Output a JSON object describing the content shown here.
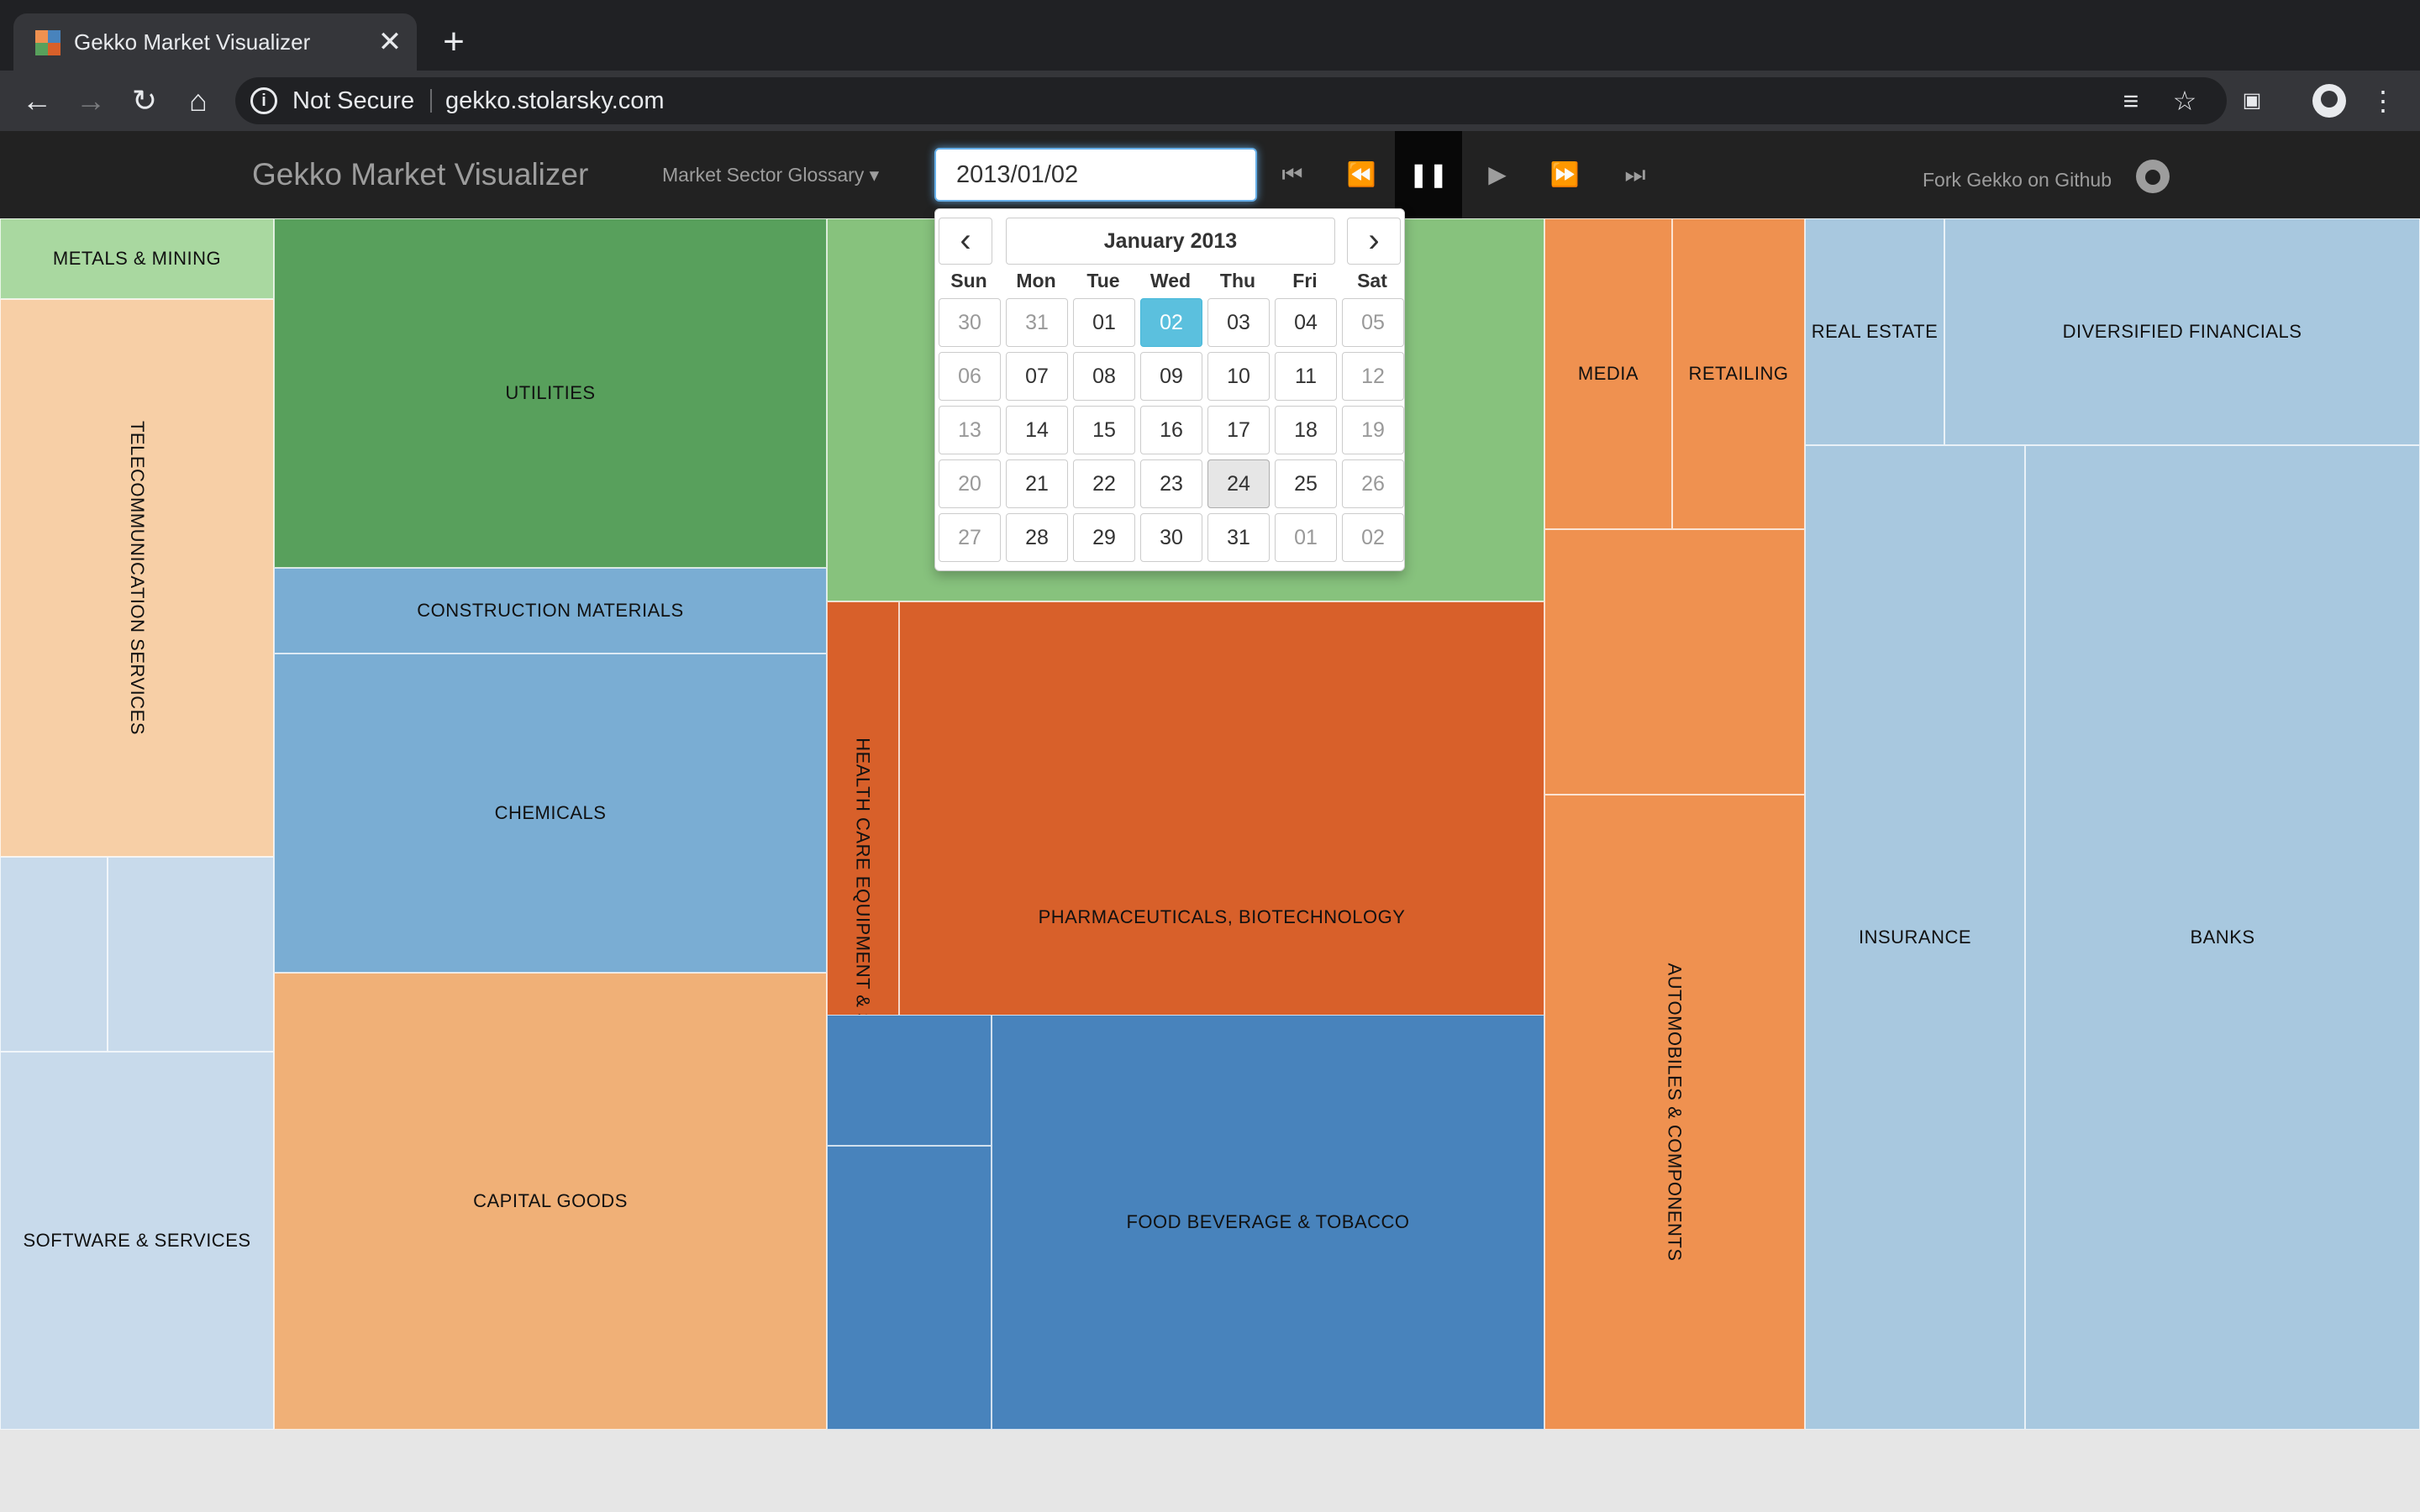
{
  "browser": {
    "tab_title": "Gekko Market Visualizer",
    "tab_close": "✕",
    "new_tab": "+",
    "security_label": "Not Secure",
    "url": "gekko.stolarsky.com"
  },
  "app": {
    "brand": "Gekko Market Visualizer",
    "glossary_label": "Market Sector Glossary ▾",
    "date_value": "2013/01/02",
    "fork_label": "Fork Gekko on Github"
  },
  "datepicker": {
    "month_label": "January 2013",
    "prev_icon": "‹",
    "next_icon": "›",
    "weekdays": [
      "Sun",
      "Mon",
      "Tue",
      "Wed",
      "Thu",
      "Fri",
      "Sat"
    ],
    "days": [
      {
        "label": "30",
        "state": "muted"
      },
      {
        "label": "31",
        "state": "muted"
      },
      {
        "label": "01",
        "state": ""
      },
      {
        "label": "02",
        "state": "active"
      },
      {
        "label": "03",
        "state": ""
      },
      {
        "label": "04",
        "state": ""
      },
      {
        "label": "05",
        "state": "muted"
      },
      {
        "label": "06",
        "state": "muted"
      },
      {
        "label": "07",
        "state": ""
      },
      {
        "label": "08",
        "state": ""
      },
      {
        "label": "09",
        "state": ""
      },
      {
        "label": "10",
        "state": ""
      },
      {
        "label": "11",
        "state": ""
      },
      {
        "label": "12",
        "state": "muted"
      },
      {
        "label": "13",
        "state": "muted"
      },
      {
        "label": "14",
        "state": ""
      },
      {
        "label": "15",
        "state": ""
      },
      {
        "label": "16",
        "state": ""
      },
      {
        "label": "17",
        "state": ""
      },
      {
        "label": "18",
        "state": ""
      },
      {
        "label": "19",
        "state": "muted"
      },
      {
        "label": "20",
        "state": "muted"
      },
      {
        "label": "21",
        "state": ""
      },
      {
        "label": "22",
        "state": ""
      },
      {
        "label": "23",
        "state": ""
      },
      {
        "label": "24",
        "state": "today"
      },
      {
        "label": "25",
        "state": ""
      },
      {
        "label": "26",
        "state": "muted"
      },
      {
        "label": "27",
        "state": "muted"
      },
      {
        "label": "28",
        "state": ""
      },
      {
        "label": "29",
        "state": ""
      },
      {
        "label": "30",
        "state": ""
      },
      {
        "label": "31",
        "state": ""
      },
      {
        "label": "01",
        "state": "muted"
      },
      {
        "label": "02",
        "state": "muted"
      }
    ]
  },
  "colors": {
    "light_green": "#a9d8a0",
    "green": "#58a05c",
    "mid_green": "#87c27d",
    "peach": "#f7cfa6",
    "light_orange": "#f0b077",
    "orange": "#ef9150",
    "dark_orange": "#d8602a",
    "light_blue": "#c8daeb",
    "blue": "#7aadd3",
    "pale_blue": "#a8c8df",
    "steel_blue": "#4883bc",
    "active_date": "#5bc0de"
  },
  "sectors": {
    "metals_mining": "METALS & MINING",
    "telecom": "TELECOMMUNICATION SERVICES",
    "utilities": "UTILITIES",
    "construction_materials": "CONSTRUCTION MATERIALS",
    "chemicals": "CHEMICALS",
    "capital_goods": "CAPITAL GOODS",
    "software_services": "SOFTWARE & SERVICES",
    "health_care": "HEALTH CARE EQUIPMENT & SERVICE",
    "pharma": "PHARMACEUTICALS, BIOTECHNOLOGY",
    "food_beverage": "FOOD BEVERAGE & TOBACCO",
    "media": "MEDIA",
    "retailing": "RETAILING",
    "automobiles": "AUTOMOBILES & COMPONENTS",
    "real_estate": "REAL ESTATE",
    "diversified_financials": "DIVERSIFIED FINANCIALS",
    "insurance": "INSURANCE",
    "banks": "BANKS"
  }
}
